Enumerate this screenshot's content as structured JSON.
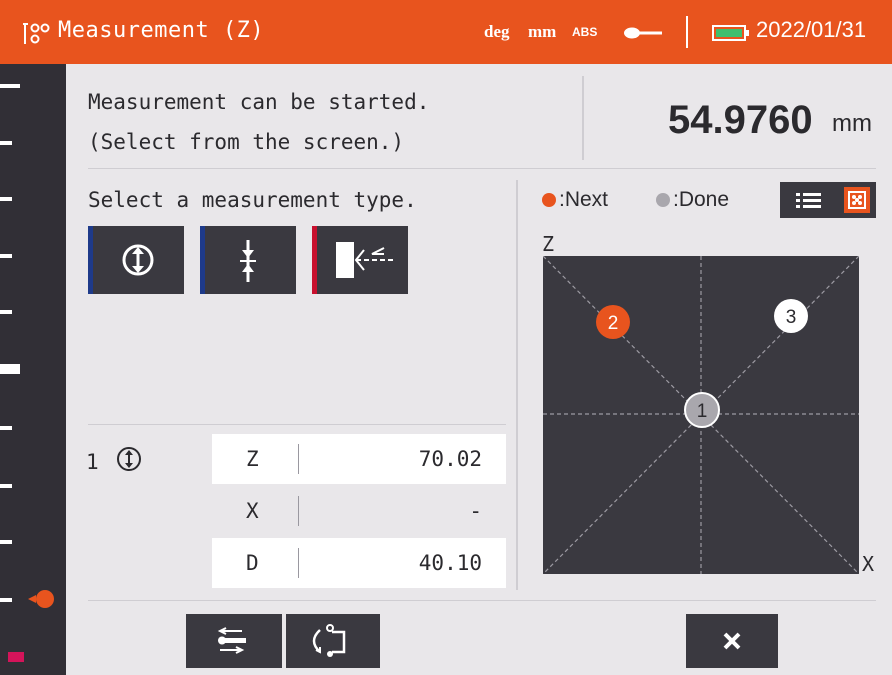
{
  "header": {
    "title": "Measurement (Z)",
    "unit_angle": "deg",
    "unit_length": "mm",
    "mode": "ABS",
    "date": "2022/01/31",
    "icons": [
      "measurement-app-icon",
      "key-icon",
      "battery-icon"
    ]
  },
  "status": {
    "line1": "Measurement can be started.",
    "line2": "(Select from the screen.)"
  },
  "reading": {
    "value": "54.9760",
    "unit": "mm"
  },
  "select": {
    "prompt": "Select a measurement type.",
    "types": [
      {
        "icon": "up-down-circle-icon",
        "stripe": "#1e3a8a"
      },
      {
        "icon": "point-axis-icon",
        "stripe": "#1e3a8a"
      },
      {
        "icon": "block-arrow-icon",
        "stripe": "#c8102e"
      }
    ]
  },
  "legend": {
    "next_label": ":Next",
    "done_label": ":Done",
    "next_color": "#e8541e",
    "done_color": "#a9a7ad"
  },
  "view_toggle": {
    "options": [
      "list-view-icon",
      "diagram-view-icon"
    ],
    "active": "diagram-view-icon"
  },
  "diagram": {
    "axis_vertical": "Z",
    "axis_horizontal": "X",
    "points": [
      {
        "label": "1",
        "state": "done",
        "fill": "#a9a7ad"
      },
      {
        "label": "2",
        "state": "next",
        "fill": "#e8541e"
      },
      {
        "label": "3",
        "state": "pending",
        "fill": "#ffffff"
      }
    ]
  },
  "results": {
    "row_number": "1",
    "row_icon": "up-down-circle-icon",
    "fields": [
      {
        "label": "Z",
        "value": "70.02",
        "highlight": true
      },
      {
        "label": "X",
        "value": "-",
        "highlight": false
      },
      {
        "label": "D",
        "value": "40.10",
        "highlight": true
      }
    ]
  },
  "toolbar": {
    "buttons": [
      "data-output-icon",
      "reset-cycle-icon",
      "close-icon"
    ]
  },
  "colors": {
    "accent": "#e8541e",
    "panel_dark": "#3a3940",
    "background": "#e9e7ea"
  }
}
